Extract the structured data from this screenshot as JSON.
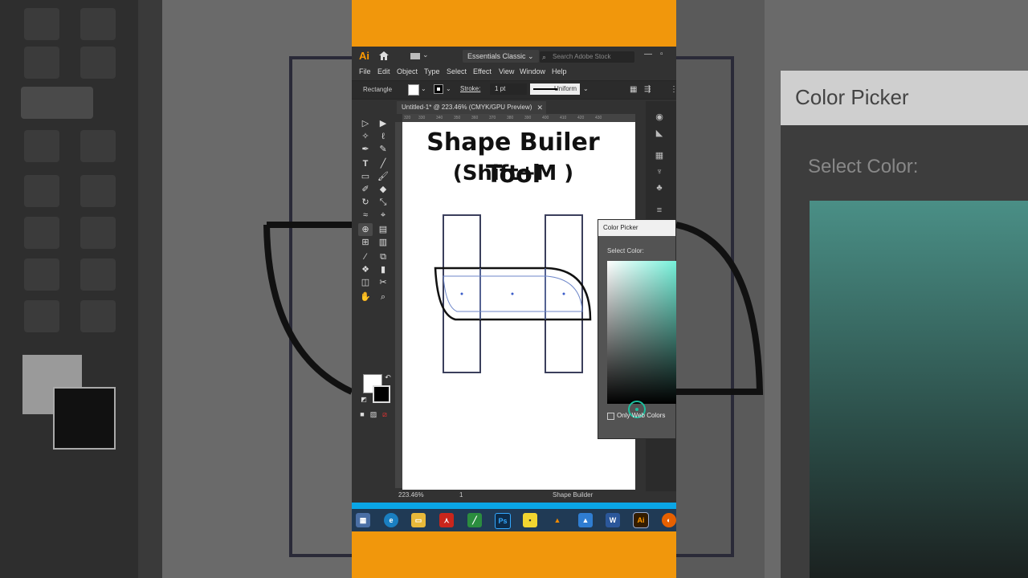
{
  "app": {
    "logo": "Ai",
    "workspace": "Essentials Classic",
    "search_placeholder": "Search Adobe Stock"
  },
  "menu": [
    "File",
    "Edit",
    "Object",
    "Type",
    "Select",
    "Effect",
    "View",
    "Window",
    "Help"
  ],
  "control_bar": {
    "object_type": "Rectangle",
    "stroke_label": "Stroke:",
    "stroke_weight": "1 pt",
    "profile": "Uniform"
  },
  "document": {
    "tab_title": "Untitled-1* @ 223.46% (CMYK/GPU Preview)",
    "ruler_ticks": [
      "320",
      "330",
      "340",
      "350",
      "360",
      "370",
      "380",
      "390",
      "400",
      "410",
      "420",
      "430"
    ]
  },
  "artboard": {
    "title": "Shape Builer Tool",
    "subtitle": "(Shift+M )"
  },
  "status_bar": {
    "zoom": "223.46%",
    "page": "1",
    "tool": "Shape Builder"
  },
  "color_picker": {
    "title": "Color Picker",
    "select_label": "Select Color:",
    "only_web_colors": "Only Web Colors"
  },
  "background": {
    "panel_title": "Color Picker",
    "panel_sub": "Select Color:"
  },
  "colors": {
    "frame": "#f1970c",
    "taskbar_accent": "#0aa6e6",
    "picker_ring": "#1dbf9e"
  }
}
